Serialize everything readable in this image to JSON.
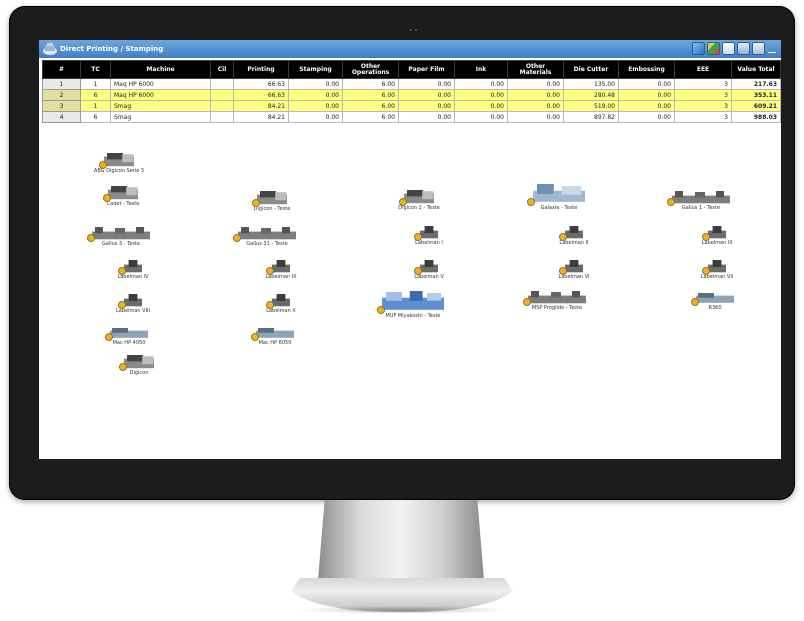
{
  "window": {
    "title": "Direct Printing / Stamping"
  },
  "colors": {
    "titlebar": "#4a8acb",
    "header_bg": "#000000",
    "highlight_row": "#ffff80"
  },
  "toolbar_icons": [
    "chart-icon",
    "palette-icon",
    "document-icon",
    "print-icon",
    "settings-icon"
  ],
  "table": {
    "headers": [
      "#",
      "TC",
      "Machine",
      "Cil",
      "Printing",
      "Stamping",
      "Other Operations",
      "Paper Film",
      "Ink",
      "Other Materials",
      "Die Cutter",
      "Embossing",
      "EEE",
      "Value Total"
    ],
    "rows": [
      {
        "n": "1",
        "tc": "1",
        "machine": "Maq HP 6000",
        "cil": "",
        "printing": "66.63",
        "stamping": "0.00",
        "other_ops": "6.00",
        "paper": "0.00",
        "ink": "0.00",
        "other_mat": "0.00",
        "die": "135.00",
        "emb": "0.00",
        "eee": "3",
        "total": "217.63",
        "highlight": false
      },
      {
        "n": "2",
        "tc": "6",
        "machine": "Maq HP 6000",
        "cil": "",
        "printing": "66.63",
        "stamping": "0.00",
        "other_ops": "6.00",
        "paper": "0.00",
        "ink": "0.00",
        "other_mat": "0.00",
        "die": "280.48",
        "emb": "0.00",
        "eee": "3",
        "total": "353.11",
        "highlight": true
      },
      {
        "n": "3",
        "tc": "1",
        "machine": "Smag",
        "cil": "",
        "printing": "84.21",
        "stamping": "0.00",
        "other_ops": "6.00",
        "paper": "0.00",
        "ink": "0.00",
        "other_mat": "0.00",
        "die": "519.00",
        "emb": "0.00",
        "eee": "3",
        "total": "609.21",
        "highlight": true
      },
      {
        "n": "4",
        "tc": "6",
        "machine": "Smag",
        "cil": "",
        "printing": "84.21",
        "stamping": "0.00",
        "other_ops": "6.00",
        "paper": "0.00",
        "ink": "0.00",
        "other_mat": "0.00",
        "die": "897.82",
        "emb": "0.00",
        "eee": "3",
        "total": "988.03",
        "highlight": false
      }
    ]
  },
  "machines": [
    {
      "label": "ABG Digicon Serie 3"
    },
    {
      "label": "Cadet - Teste"
    },
    {
      "label": "Digicon - Teste"
    },
    {
      "label": "Digicon 2 - Teste"
    },
    {
      "label": "Galaxie - Teste"
    },
    {
      "label": "Gallus 1 - Teste"
    },
    {
      "label": "Gallus 3 - Teste"
    },
    {
      "label": "Gallus 31 - Teste"
    },
    {
      "label": "Labelman I"
    },
    {
      "label": "Labelman II"
    },
    {
      "label": "Labelman III"
    },
    {
      "label": "Labelman IV"
    },
    {
      "label": "Labelman IX"
    },
    {
      "label": "Labelman V"
    },
    {
      "label": "Labelman VI"
    },
    {
      "label": "Labelman VII"
    },
    {
      "label": "Labelman VIII"
    },
    {
      "label": "Labelman X"
    },
    {
      "label": "MUF Miyakoshi - Teste"
    },
    {
      "label": "MSP Proglide - Teste"
    },
    {
      "label": "R360"
    },
    {
      "label": "Mac HP 4050"
    },
    {
      "label": "Mac HP 6050"
    },
    {
      "label": "Digicon"
    }
  ]
}
